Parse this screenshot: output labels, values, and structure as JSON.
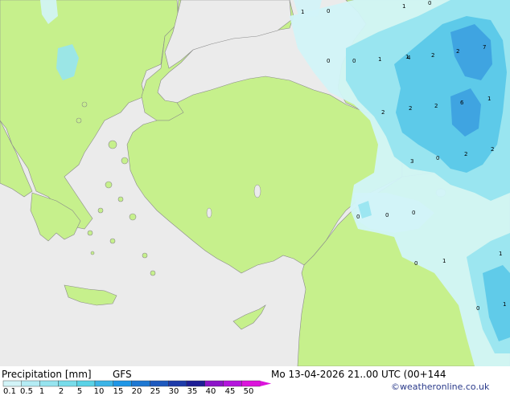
{
  "footer": {
    "title": "Precipitation [mm]",
    "model": "GFS",
    "valid_time": "Mo 13-04-2026 21..00 UTC (00+144",
    "credit": "©weatheronline.co.uk"
  },
  "legend": {
    "ticks": [
      "0.1",
      "0.5",
      "1",
      "2",
      "5",
      "10",
      "15",
      "20",
      "25",
      "30",
      "35",
      "40",
      "45",
      "50"
    ],
    "colors": [
      "#d2f4f8",
      "#b4ecf4",
      "#96e4ef",
      "#78dcea",
      "#5ad2e6",
      "#3cb4e6",
      "#1e96e6",
      "#1e78d2",
      "#1e5abe",
      "#1e3caa",
      "#1e1e96",
      "#8c14c8",
      "#b414dc",
      "#dc14dc"
    ]
  },
  "colors": {
    "sea": "#ebebeb",
    "land": "#c6f08c",
    "precip_light": "#d2f4f8",
    "precip_mid": "#96e4ef",
    "precip_heavy": "#5ac8e8",
    "precip_core": "#3ca0e0"
  },
  "map_labels": [
    "1",
    "0",
    "1",
    "0",
    "1",
    "2",
    "7",
    "0",
    "0",
    "1",
    "4",
    "2",
    "2",
    "6",
    "2",
    "1",
    "2",
    "3",
    "0",
    "2",
    "2",
    "0",
    "0",
    "0",
    "0",
    "1",
    "1",
    "0",
    "1"
  ]
}
